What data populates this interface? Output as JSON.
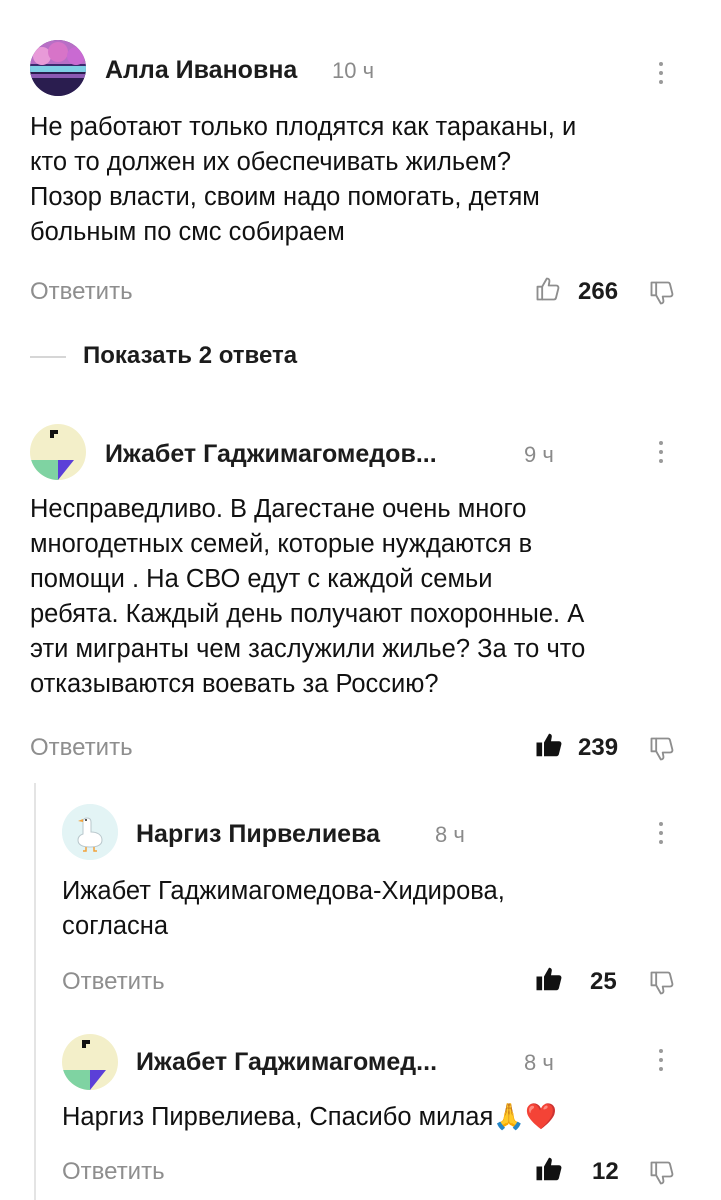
{
  "comments": [
    {
      "author": "Алла Ивановна",
      "time": "10 ч",
      "text_lines": [
        "Не работают только плодятся как тараканы, и",
        "кто то должен их обеспечивать жильем?",
        "Позор власти, своим надо помогать, детям",
        "больным по смс собираем"
      ],
      "reply_label": "Ответить",
      "likes": "266",
      "like_icon": "thumb-up-outline-icon",
      "avatar_icon": "landscape-photo-avatar"
    },
    {
      "author": "Ижабет Гаджимагомедов...",
      "time": "9 ч",
      "text_lines": [
        "Несправедливо. В Дагестане очень много",
        "многодетных семей, которые нуждаются в",
        "помощи . На СВО едут с каждой семьи",
        "ребята. Каждый день получают похоронные. А",
        "эти мигранты чем заслужили жилье? За то что",
        "отказываются воевать за Россию?"
      ],
      "reply_label": "Ответить",
      "likes": "239",
      "like_icon": "thumb-up-filled-icon",
      "avatar_icon": "abstract-shapes-avatar"
    },
    {
      "author": "Наргиз Пирвелиева",
      "time": "8 ч",
      "text_lines": [
        "Ижабет Гаджимагомедова-Хидирова,",
        "согласна"
      ],
      "reply_label": "Ответить",
      "likes": "25",
      "like_icon": "thumb-up-filled-icon",
      "avatar_icon": "goose-avatar"
    },
    {
      "author": "Ижабет Гаджимагомед...",
      "time": "8 ч",
      "text_lines": [
        "Наргиз Пирвелиева, Спасибо милая"
      ],
      "emoji": [
        "🙏",
        "❤️"
      ],
      "reply_label": "Ответить",
      "likes": "12",
      "like_icon": "thumb-up-filled-icon",
      "avatar_icon": "abstract-shapes-avatar"
    }
  ],
  "show_replies_label": "Показать 2 ответа",
  "colors": {
    "muted": "#8e8e8e",
    "text": "#111111",
    "accent_purple": "#5b3fd8",
    "accent_green": "#7fd3a2",
    "avatar_cream": "#f3efc9"
  }
}
